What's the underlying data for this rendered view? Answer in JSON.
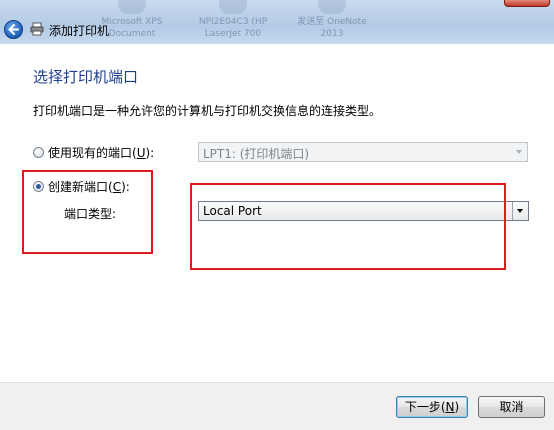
{
  "window": {
    "title": "添加打印机",
    "background_thumbnails": [
      "Microsoft XPS\nDocument",
      "NPI2E04C3 (HP\nLaserJet 700",
      "发送至 OneNote\n2013"
    ]
  },
  "page": {
    "heading": "选择打印机端口",
    "description": "打印机端口是一种允许您的计算机与打印机交换信息的连接类型。"
  },
  "options": {
    "use_existing": {
      "label": "使用现有的端口",
      "mnemonic": "U",
      "selected": false
    },
    "create_new": {
      "label": "创建新端口",
      "mnemonic": "C",
      "selected": true
    },
    "port_type_label": "端口类型:"
  },
  "existing_port_combo": {
    "value": "LPT1: (打印机端口)",
    "enabled": false
  },
  "port_type_combo": {
    "value": "Local Port",
    "enabled": true
  },
  "buttons": {
    "next": {
      "label": "下一步",
      "mnemonic": "N"
    },
    "cancel": {
      "label": "取消"
    }
  },
  "colors": {
    "heading": "#1f3f8f",
    "highlight": "#e01b1b",
    "titlebar": "#b3cbe6"
  }
}
